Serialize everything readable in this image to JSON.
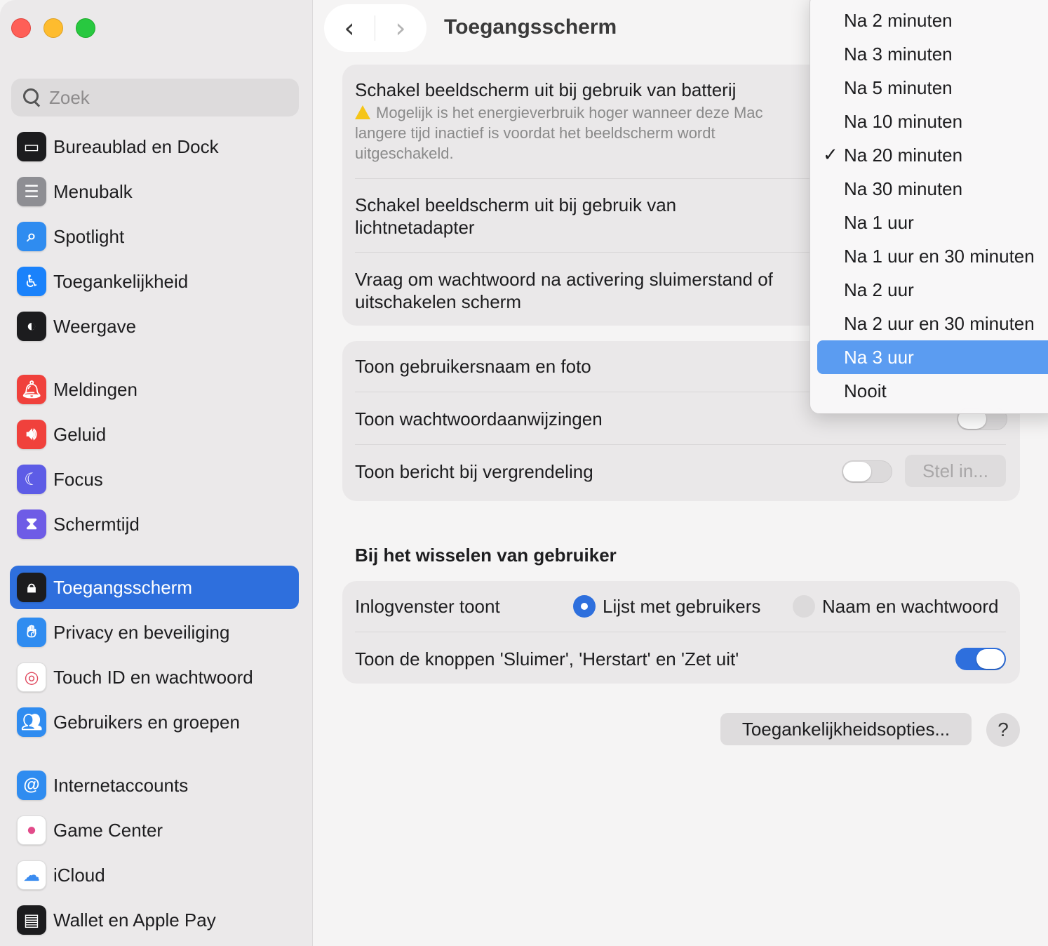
{
  "window": {
    "title": "Toegangsscherm"
  },
  "sidebar": {
    "search_placeholder": "Zoek",
    "groups": [
      [
        {
          "label": "Bureaublad en Dock",
          "icon": "dock-icon",
          "color": "#1c1c1e"
        },
        {
          "label": "Menubalk",
          "icon": "menubar-icon",
          "color": "#8e8e93"
        },
        {
          "label": "Spotlight",
          "icon": "magnifier-icon",
          "color": "#2f8cf0"
        },
        {
          "label": "Toegankelijkheid",
          "icon": "accessibility-icon",
          "color": "#1a82fb"
        },
        {
          "label": "Weergave",
          "icon": "appearance-icon",
          "color": "#1c1c1e"
        }
      ],
      [
        {
          "label": "Meldingen",
          "icon": "bell-icon",
          "color": "#f0413c"
        },
        {
          "label": "Geluid",
          "icon": "speaker-icon",
          "color": "#f0413c"
        },
        {
          "label": "Focus",
          "icon": "moon-icon",
          "color": "#5d5ce6"
        },
        {
          "label": "Schermtijd",
          "icon": "hourglass-icon",
          "color": "#6e5ce6"
        }
      ],
      [
        {
          "label": "Toegangsscherm",
          "icon": "lock-screen-icon",
          "color": "#1c1c1e",
          "active": true
        },
        {
          "label": "Privacy en beveiliging",
          "icon": "hand-icon",
          "color": "#2f8cf0"
        },
        {
          "label": "Touch ID en wachtwoord",
          "icon": "fingerprint-icon",
          "color": "#ffffff"
        },
        {
          "label": "Gebruikers en groepen",
          "icon": "users-icon",
          "color": "#2f8cf0"
        }
      ],
      [
        {
          "label": "Internetaccounts",
          "icon": "at-icon",
          "color": "#2f8cf0"
        },
        {
          "label": "Game Center",
          "icon": "game-center-icon",
          "color": "#ffffff"
        },
        {
          "label": "iCloud",
          "icon": "cloud-icon",
          "color": "#ffffff"
        },
        {
          "label": "Wallet en Apple Pay",
          "icon": "wallet-icon",
          "color": "#1c1c1e"
        }
      ]
    ]
  },
  "main": {
    "card1": {
      "battery_label": "Schakel beeldscherm uit bij gebruik van batterij",
      "battery_warning": "Mogelijk is het energieverbruik hoger wanneer deze Mac langere tijd inactief is voordat het beeldscherm wordt uitgeschakeld.",
      "adapter_label_1": "Schakel beeldscherm uit bij gebruik van",
      "adapter_label_2": "lichtnetadapter",
      "password_label_1": "Vraag om wachtwoord na activering sluimerstand of",
      "password_label_2": "uitschakelen scherm"
    },
    "card2": {
      "show_name_photo": "Toon gebruikersnaam en foto",
      "show_hints": "Toon wachtwoordaanwijzingen",
      "show_message": "Toon bericht bij vergrendeling",
      "setup_button": "Stel in..."
    },
    "switch_section": {
      "title": "Bij het wisselen van gebruiker",
      "login_window_label": "Inlogvenster toont",
      "option_list": "Lijst met gebruikers",
      "option_name": "Naam en wachtwoord",
      "selected": "Lijst met gebruikers",
      "show_buttons_label": "Toon de knoppen 'Sluimer', 'Herstart' en 'Zet uit'",
      "show_buttons_on": true
    },
    "accessibility_button": "Toegankelijkheidsopties...",
    "help_button": "?"
  },
  "dropdown": {
    "options": [
      "Na 2 minuten",
      "Na 3 minuten",
      "Na 5 minuten",
      "Na 10 minuten",
      "Na 20 minuten",
      "Na 30 minuten",
      "Na 1 uur",
      "Na 1 uur en 30 minuten",
      "Na 2 uur",
      "Na 2 uur en 30 minuten",
      "Na 3 uur",
      "Nooit"
    ],
    "checked": "Na 20 minuten",
    "highlighted": "Na 3 uur",
    "check_mark": "✓"
  },
  "colors": {
    "accent": "#2e6fdd",
    "highlight": "#5b9cf1"
  }
}
